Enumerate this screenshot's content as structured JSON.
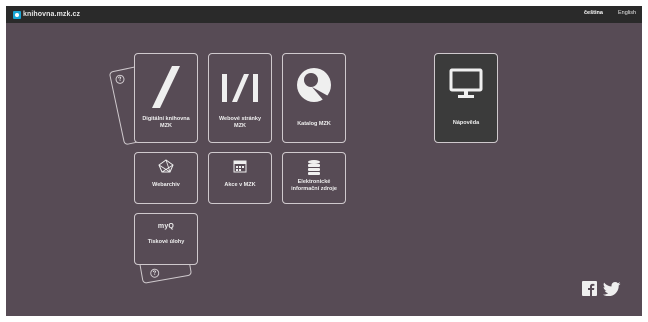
{
  "topbar": {
    "site_name": "knihovna.mzk.cz",
    "lang_cs": "čeština",
    "lang_en": "English"
  },
  "tiles": {
    "digital_library": "Digitální knihovna MZK",
    "websites": "Webové stránky MZK",
    "catalog": "Katalog MZK",
    "help": "Nápověda",
    "webarchive": "Webarchiv",
    "events": "Akce v MZK",
    "e_resources": "Elektronické informační zdroje",
    "print_jobs": "Tiskové úlohy",
    "myq_logo": "myQ"
  },
  "colors": {
    "background": "#574b55",
    "topbar": "#2a2a2a",
    "accent": "#19a6d6",
    "tile_border": "#cfc9cd"
  },
  "icons": {
    "help_card_top": "question-mark-icon",
    "help_card_bottom": "question-mark-icon",
    "facebook": "facebook-icon",
    "twitter": "twitter-icon"
  }
}
